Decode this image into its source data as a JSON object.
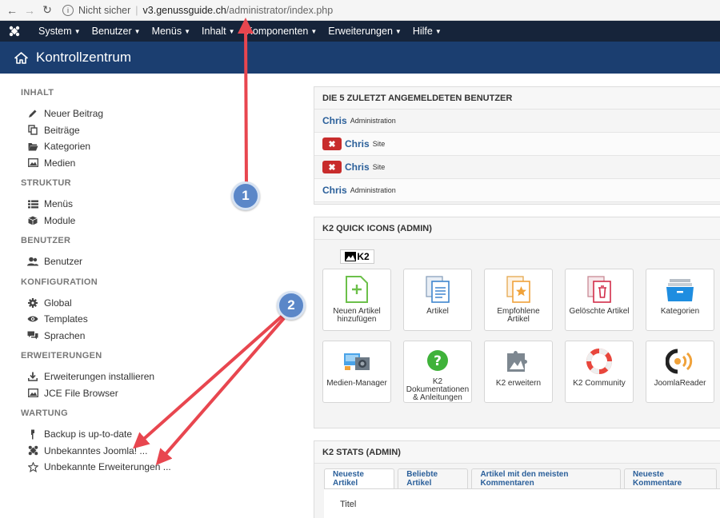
{
  "browser": {
    "security": "Nicht sicher",
    "domain": "v3.genussguide.ch",
    "path": "/administrator/index.php"
  },
  "menu": {
    "items": [
      "System",
      "Benutzer",
      "Menüs",
      "Inhalt",
      "Komponenten",
      "Erweiterungen",
      "Hilfe"
    ]
  },
  "title": "Kontrollzentrum",
  "sidebar": {
    "sections": [
      {
        "heading": "INHALT",
        "items": [
          "Neuer Beitrag",
          "Beiträge",
          "Kategorien",
          "Medien"
        ]
      },
      {
        "heading": "STRUKTUR",
        "items": [
          "Menüs",
          "Module"
        ]
      },
      {
        "heading": "BENUTZER",
        "items": [
          "Benutzer"
        ]
      },
      {
        "heading": "KONFIGURATION",
        "items": [
          "Global",
          "Templates",
          "Sprachen"
        ]
      },
      {
        "heading": "ERWEITERUNGEN",
        "items": [
          "Erweiterungen installieren",
          "JCE File Browser"
        ]
      },
      {
        "heading": "WARTUNG",
        "items": [
          "Backup is up-to-date",
          "Unbekanntes Joomla! ...",
          "Unbekannte Erweiterungen ..."
        ]
      }
    ]
  },
  "logged_users": {
    "heading": "DIE 5 ZULETZT ANGEMELDETEN BENUTZER",
    "rows": [
      {
        "name": "Chris",
        "client": "Administration",
        "logout": false
      },
      {
        "name": "Chris",
        "client": "Site",
        "logout": true
      },
      {
        "name": "Chris",
        "client": "Site",
        "logout": true
      },
      {
        "name": "Chris",
        "client": "Administration",
        "logout": false
      }
    ]
  },
  "k2_quick": {
    "heading": "K2 QUICK ICONS (ADMIN)",
    "logo": "K2",
    "icons": [
      {
        "label": "Neuen Artikel hinzufügen",
        "icon": "new-document-icon"
      },
      {
        "label": "Artikel",
        "icon": "documents-icon"
      },
      {
        "label": "Empfohlene Artikel",
        "icon": "featured-document-icon"
      },
      {
        "label": "Gelöschte Artikel",
        "icon": "trash-document-icon"
      },
      {
        "label": "Kategorien",
        "icon": "folder-icon"
      },
      {
        "label": "Medien-Manager",
        "icon": "media-icon"
      },
      {
        "label": "K2 Dokumentationen & Anleitungen",
        "icon": "help-icon"
      },
      {
        "label": "K2 erweitern",
        "icon": "puzzle-icon"
      },
      {
        "label": "K2 Community",
        "icon": "lifebuoy-icon"
      },
      {
        "label": "JoomlaReader",
        "icon": "reader-icon"
      }
    ]
  },
  "k2_stats": {
    "heading": "K2 STATS (ADMIN)",
    "tabs": [
      "Neueste Artikel",
      "Beliebte Artikel",
      "Artikel mit den meisten Kommentaren",
      "Neueste Kommentare"
    ],
    "column": "Titel"
  },
  "annotations": [
    "1",
    "2"
  ],
  "colors": {
    "admin_menu": "#16243a",
    "title_bar": "#1b3e70",
    "link": "#2a5f9a",
    "arrow": "#e8464f",
    "badge": "#5b87c8"
  }
}
